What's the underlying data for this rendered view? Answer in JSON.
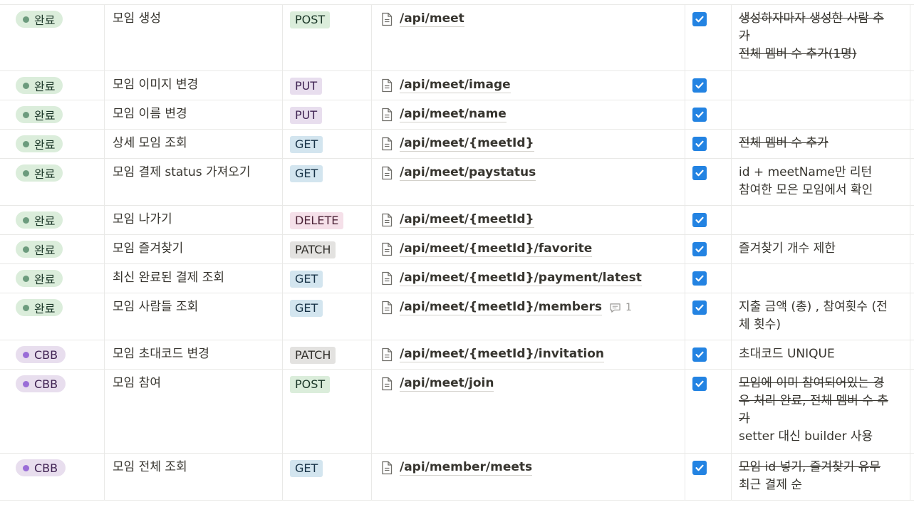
{
  "rows": [
    {
      "status": "완료",
      "status_type": "done",
      "name": "모임 생성",
      "method": "POST",
      "endpoint": "/api/meet",
      "checked": true,
      "notes": [
        {
          "text": "생성하자마자 생성한 사람 추",
          "strike": true
        },
        {
          "text": "가",
          "strike": true
        },
        {
          "text": "전체 멤버 수 추가(1명)",
          "strike": true
        }
      ]
    },
    {
      "status": "완료",
      "status_type": "done",
      "name": "모임 이미지 변경",
      "method": "PUT",
      "endpoint": "/api/meet/image",
      "checked": true,
      "notes": []
    },
    {
      "status": "완료",
      "status_type": "done",
      "name": "모임 이름 변경",
      "method": "PUT",
      "endpoint": "/api/meet/name",
      "checked": true,
      "notes": []
    },
    {
      "status": "완료",
      "status_type": "done",
      "name": "상세 모임 조회",
      "method": "GET",
      "endpoint": "/api/meet/{meetId}",
      "checked": true,
      "notes": [
        {
          "text": "전체 멤버 수 추가",
          "strike": true
        }
      ]
    },
    {
      "status": "완료",
      "status_type": "done",
      "name": "모임 결제 status 가져오기",
      "method": "GET",
      "endpoint": "/api/meet/paystatus",
      "checked": true,
      "notes": [
        {
          "text": "id + meetName만 리턴",
          "strike": false
        },
        {
          "text": "참여한 모은 모임에서 확인",
          "strike": false
        }
      ]
    },
    {
      "status": "완료",
      "status_type": "done",
      "name": "모임 나가기",
      "method": "DELETE",
      "endpoint": "/api/meet/{meetId}",
      "checked": true,
      "notes": []
    },
    {
      "status": "완료",
      "status_type": "done",
      "name": "모임 즐겨찾기",
      "method": "PATCH",
      "endpoint": "/api/meet/{meetId}/favorite",
      "checked": true,
      "notes": [
        {
          "text": "즐겨찾기 개수 제한",
          "strike": false
        }
      ]
    },
    {
      "status": "완료",
      "status_type": "done",
      "name": "최신 완료된 결제 조회",
      "method": "GET",
      "endpoint": "/api/meet/{meetId}/payment/latest",
      "checked": true,
      "notes": []
    },
    {
      "status": "완료",
      "status_type": "done",
      "name": "모임 사람들 조회",
      "method": "GET",
      "endpoint": "/api/meet/{meetId}/members",
      "checked": true,
      "comment_count": "1",
      "notes": [
        {
          "text": "지출 금액 (총) , 참여횟수 (전",
          "strike": false
        },
        {
          "text": "체 횟수)",
          "strike": false
        }
      ]
    },
    {
      "status": "CBB",
      "status_type": "cbb",
      "name": "모임 초대코드 변경",
      "method": "PATCH",
      "endpoint": "/api/meet/{meetId}/invitation",
      "checked": true,
      "notes": [
        {
          "text": "초대코드 UNIQUE",
          "strike": false
        }
      ]
    },
    {
      "status": "CBB",
      "status_type": "cbb",
      "name": "모임 참여",
      "method": "POST",
      "endpoint": "/api/meet/join",
      "checked": true,
      "notes": [
        {
          "text": "모임에 이미 참여되어있는 경",
          "strike": true
        },
        {
          "text": "우 처리 완료, 전체 멤버 수 추",
          "strike": true
        },
        {
          "text": "가",
          "strike": true
        },
        {
          "text": "setter 대신 builder 사용",
          "strike": false
        }
      ]
    },
    {
      "status": "CBB",
      "status_type": "cbb",
      "name": "모임 전체 조회",
      "method": "GET",
      "endpoint": "/api/member/meets",
      "checked": true,
      "notes": [
        {
          "text": "모임 id 넣기, 즐겨찾기 유무",
          "strike": true
        },
        {
          "text": "최근 결제 순",
          "strike": false
        }
      ]
    }
  ],
  "colors": {
    "checkbox": "#2383e2",
    "border": "#e9e9e7",
    "text": "#37352f"
  },
  "icons": {
    "endpoint": "page-icon",
    "checkbox": "checkmark-icon",
    "comment": "comment-icon"
  }
}
